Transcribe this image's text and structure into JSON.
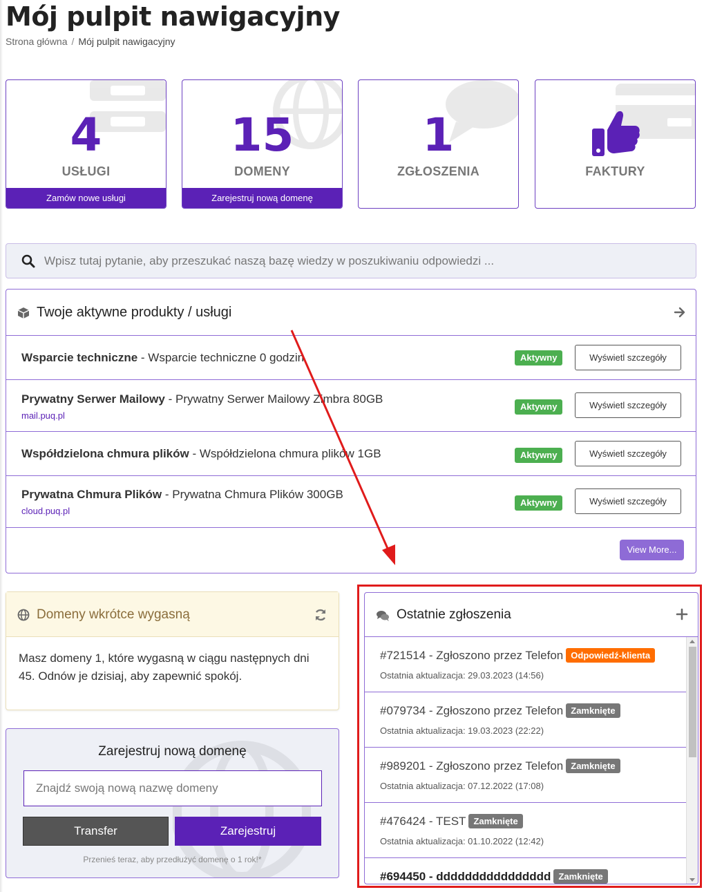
{
  "header": {
    "title": "Mój pulpit nawigacyjny",
    "breadcrumb": {
      "home": "Strona główna",
      "separator": "/",
      "current": "Mój pulpit nawigacyjny"
    }
  },
  "tiles": [
    {
      "value": "4",
      "label": "USŁUGI",
      "footer": "Zamów nowe usługi"
    },
    {
      "value": "15",
      "label": "DOMENY",
      "footer": "Zarejestruj nową domenę"
    },
    {
      "value": "1",
      "label": "ZGŁOSZENIA"
    },
    {
      "icon": "thumbs-up-icon",
      "label": "FAKTURY"
    }
  ],
  "search": {
    "placeholder": "Wpisz tutaj pytanie, aby przeszukać naszą bazę wiedzy w poszukiwaniu odpowiedzi ..."
  },
  "products": {
    "title": "Twoje aktywne produkty / usługi",
    "items": [
      {
        "name": "Wsparcie techniczne",
        "desc": " - Wsparcie techniczne 0 godzin",
        "domain": "",
        "status": "Aktywny",
        "action": "Wyświetl szczegóły"
      },
      {
        "name": "Prywatny Serwer Mailowy",
        "desc": " - Prywatny Serwer Mailowy Zimbra 80GB",
        "domain": "mail.puq.pl",
        "status": "Aktywny",
        "action": "Wyświetl szczegóły"
      },
      {
        "name": "Współdzielona chmura plików",
        "desc": " - Współdzielona chmura plików 1GB",
        "domain": "",
        "status": "Aktywny",
        "action": "Wyświetl szczegóły"
      },
      {
        "name": "Prywatna Chmura Plików",
        "desc": " - Prywatna Chmura Plików 300GB",
        "domain": "cloud.puq.pl",
        "status": "Aktywny",
        "action": "Wyświetl szczegóły"
      }
    ],
    "view_more": "View More..."
  },
  "expiring": {
    "title": "Domeny wkrótce wygasną",
    "body": "Masz domeny 1, które wygasną w ciągu następnych dni 45. Odnów je dzisiaj, aby zapewnić spokój."
  },
  "register": {
    "title": "Zarejestruj nową domenę",
    "placeholder": "Znajdź swoją nową nazwę domeny",
    "transfer": "Transfer",
    "register": "Zarejestruj",
    "note": "Przenieś teraz, aby przedłużyć domenę o 1 rok!*"
  },
  "tickets": {
    "title": "Ostatnie zgłoszenia",
    "items": [
      {
        "subject": "#721514 - Zgłoszono przez Telefon",
        "status": "Odpowiedź-klienta",
        "status_color": "#ff6d00",
        "updated": "Ostatnia aktualizacja: 29.03.2023 (14:56)",
        "bold": false
      },
      {
        "subject": "#079734 - Zgłoszono przez Telefon",
        "status": "Zamknięte",
        "status_color": "#777777",
        "updated": "Ostatnia aktualizacja: 19.03.2023 (22:22)",
        "bold": false
      },
      {
        "subject": "#989201 - Zgłoszono przez Telefon",
        "status": "Zamknięte",
        "status_color": "#777777",
        "updated": "Ostatnia aktualizacja: 07.12.2022 (17:08)",
        "bold": false
      },
      {
        "subject": "#476424 - TEST",
        "status": "Zamknięte",
        "status_color": "#777777",
        "updated": "Ostatnia aktualizacja: 01.10.2022 (12:42)",
        "bold": false
      },
      {
        "subject": "#694450 - dddddddddddddddd",
        "status": "Zamknięte",
        "status_color": "#777777",
        "updated": "",
        "bold": true
      }
    ]
  },
  "colors": {
    "brand": "#5b21b6",
    "brand_light": "#8e6bd6",
    "active": "#4caf50",
    "annotation": "#e01b1b"
  }
}
